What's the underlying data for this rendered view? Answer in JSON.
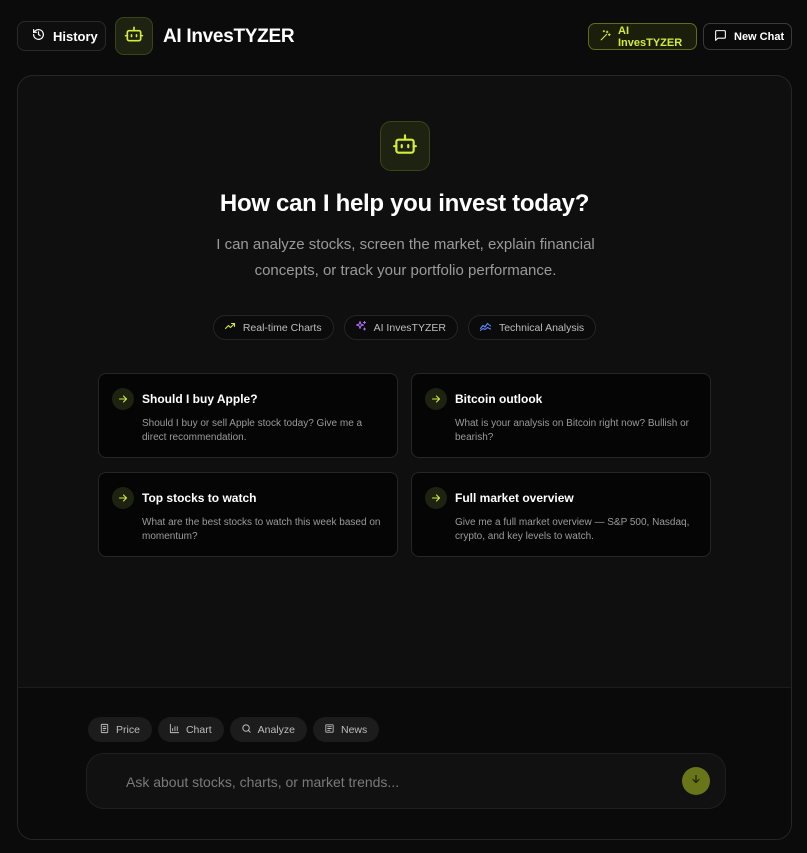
{
  "header": {
    "history_label": "History",
    "brand": "AI InvesTYZER",
    "mode_label": "AI InvesTYZER",
    "new_chat_label": "New Chat"
  },
  "hero": {
    "title": "How can I help you invest today?",
    "subtitle": "I can analyze stocks, screen the market, explain financial concepts, or track your portfolio performance."
  },
  "features": [
    {
      "label": "Real-time Charts",
      "icon": "trend-up-icon"
    },
    {
      "label": "AI InvesTYZER",
      "icon": "sparkle-icon"
    },
    {
      "label": "Technical Analysis",
      "icon": "activity-icon"
    }
  ],
  "suggestions": [
    {
      "title": "Should I buy Apple?",
      "description": "Should I buy or sell Apple stock today? Give me a direct recommendation."
    },
    {
      "title": "Bitcoin outlook",
      "description": "What is your analysis on Bitcoin right now? Bullish or bearish?"
    },
    {
      "title": "Top stocks to watch",
      "description": "What are the best stocks to watch this week based on momentum?"
    },
    {
      "title": "Full market overview",
      "description": "Give me a full market overview — S&P 500, Nasdaq, crypto, and key levels to watch."
    }
  ],
  "quick_actions": [
    {
      "label": "Price",
      "icon": "receipt-icon"
    },
    {
      "label": "Chart",
      "icon": "bar-chart-icon"
    },
    {
      "label": "Analyze",
      "icon": "search-icon"
    },
    {
      "label": "News",
      "icon": "newspaper-icon"
    }
  ],
  "composer": {
    "placeholder": "Ask about stocks, charts, or market trends...",
    "value": ""
  },
  "colors": {
    "accent": "#d4ec3c",
    "accent_dark": "#687519",
    "background": "#0b0b0b"
  }
}
